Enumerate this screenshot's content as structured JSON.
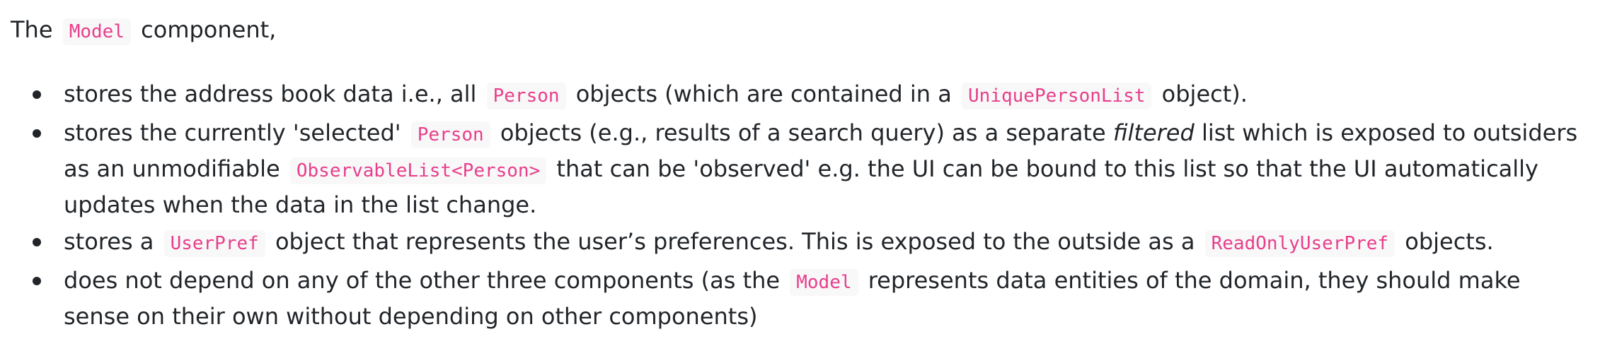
{
  "intro": {
    "prefix": "The",
    "code": "Model",
    "suffix": "component,"
  },
  "items": [
    {
      "t1": "stores the address book data i.e., all",
      "c1": "Person",
      "t2": "objects (which are contained in a",
      "c2": "UniquePersonList",
      "t3": "object)."
    },
    {
      "t1": "stores the currently 'selected'",
      "c1": "Person",
      "t2": "objects (e.g., results of a search query) as a separate",
      "em": "filtered",
      "t3": "list which is exposed to outsiders as an unmodifiable",
      "c2": "ObservableList<Person>",
      "t4": "that can be 'observed' e.g. the UI can be bound to this list so that the UI automatically updates when the data in the list change."
    },
    {
      "t1": "stores a",
      "c1": "UserPref",
      "t2": "object that represents the user’s preferences. This is exposed to the outside as a",
      "c2": "ReadOnlyUserPref",
      "t3": "objects."
    },
    {
      "t1": "does not depend on any of the other three components (as the",
      "c1": "Model",
      "t2": "represents data entities of the domain, they should make sense on their own without depending on other components)"
    }
  ]
}
